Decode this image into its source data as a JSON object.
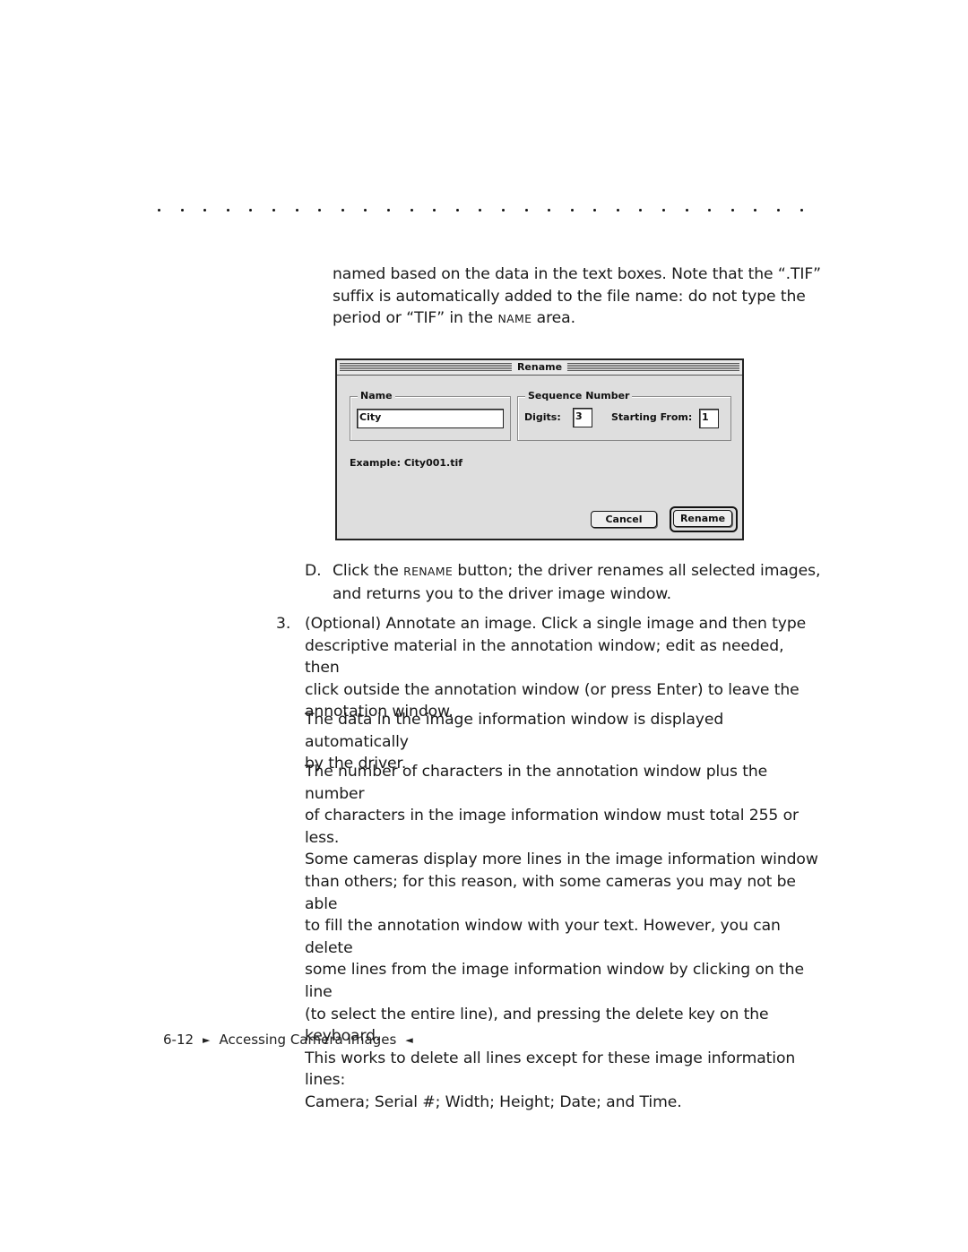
{
  "page": {
    "dots_count": 29,
    "intro": {
      "line1": "named based on the data in the text boxes. Note that  the “.TIF”",
      "line2": "suffix is automatically added to the file name: do not type the",
      "line3_pre": "period or “TIF” in the ",
      "line3_sc": "Name",
      "line3_post": " area."
    },
    "dialog": {
      "title": "Rename",
      "name_group_label": "Name",
      "name_value": "City",
      "sequence_group_label": "Sequence Number",
      "digits_label": "Digits:",
      "digits_value": "3",
      "starting_from_label": "Starting From:",
      "starting_from_value": "1",
      "example_text": "Example:  City001.tif",
      "cancel_label": "Cancel",
      "rename_label": "Rename"
    },
    "step_d": {
      "marker": "D.",
      "line1_pre": "Click the ",
      "line1_sc": "Rename",
      "line1_post": " button; the driver renames all selected images,",
      "line2": "and returns you to the driver image window."
    },
    "step_3": {
      "marker": "3.",
      "lines": [
        "(Optional) Annotate an image. Click a single image and then type",
        "descriptive material in the annotation window; edit as needed, then",
        "click outside the annotation window (or press Enter) to leave the",
        "annotation window."
      ]
    },
    "para_info": [
      "The data in the image information window is displayed automatically",
      "by the driver."
    ],
    "para_chars": [
      "The number of characters in the annotation window plus the number",
      "of characters in the image information window must total 255 or less.",
      "Some cameras display more lines in the image information window",
      "than others; for this reason, with some cameras you may not be able",
      "to fill the annotation window with your text. However, you can delete",
      "some lines from the image information window by clicking on the line",
      "(to select the entire line), and pressing the delete key on the keyboard.",
      "This works to delete all lines except for these image information lines:",
      "Camera; Serial #; Width; Height; Date; and Time."
    ],
    "footer": {
      "page_number": "6-12",
      "left_marker": "►",
      "section": "Accessing Camera Images",
      "right_marker": "◄"
    }
  }
}
